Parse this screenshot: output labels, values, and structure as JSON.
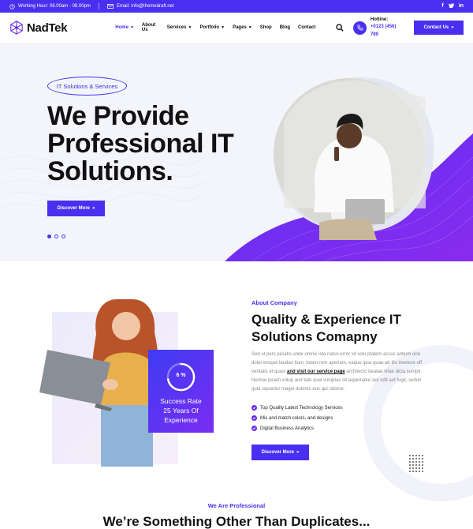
{
  "topbar": {
    "working_hour": "Working Hour: 08.00am - 09.00pm",
    "email": "Email: info@themedraft.net",
    "socials": [
      "f",
      "t",
      "in"
    ]
  },
  "header": {
    "logo": "NadTek",
    "nav": [
      {
        "label": "Home",
        "dropdown": true,
        "active": true
      },
      {
        "label": "About Us",
        "dropdown": false
      },
      {
        "label": "Services",
        "dropdown": true
      },
      {
        "label": "Portfolio",
        "dropdown": true
      },
      {
        "label": "Pages",
        "dropdown": true
      },
      {
        "label": "Shop",
        "dropdown": false
      },
      {
        "label": "Blog",
        "dropdown": false
      },
      {
        "label": "Contact",
        "dropdown": false
      }
    ],
    "hotline_label": "Hotline:",
    "hotline_number": "+0123 (456) 789",
    "contact_button": "Contact Us"
  },
  "hero": {
    "badge": "IT Solutions & Services",
    "title_line1": "We Provide",
    "title_line2": "Professional IT",
    "title_line3": "Solutions.",
    "button": "Discover More",
    "slide_count": 3,
    "active_slide": 1
  },
  "about": {
    "label": "About Company",
    "title_line1": "Quality & Experience IT",
    "title_line2": "Solutions Comapny",
    "body_before": "Sed ut pers piciatis unde omnis iste natus error sit volu ptatem accus antium one dolor emque laudan tium, totam rem aperiam, eaque ipsa quae ab illo invetore off veritatis et quasi ",
    "body_link": "and visit our service page",
    "body_after": " architecto beatae vitae dicta suntpli. Nemoe ipsam volup and tate quia voluptas sit aspernatur aut odit aut fugit, sedun quia cquuntur magni dolores eos qui ratione.",
    "checks": [
      "Top Quality Latest Technology Services",
      "Mix and match colors, and designs",
      "Digital Business Analytics"
    ],
    "button": "Discover More",
    "success_percent": 6,
    "success_percent_text": "6 %",
    "success_line1": "Success Rate",
    "success_line2": "25 Years Of",
    "success_line3": "Experience"
  },
  "professional": {
    "label": "We Are Professional",
    "title": "We’re Something Other Than Duplicates..."
  },
  "colors": {
    "primary": "#4a2ff0",
    "gradient_start": "#3d3cf2",
    "gradient_end": "#7b2cf2"
  }
}
